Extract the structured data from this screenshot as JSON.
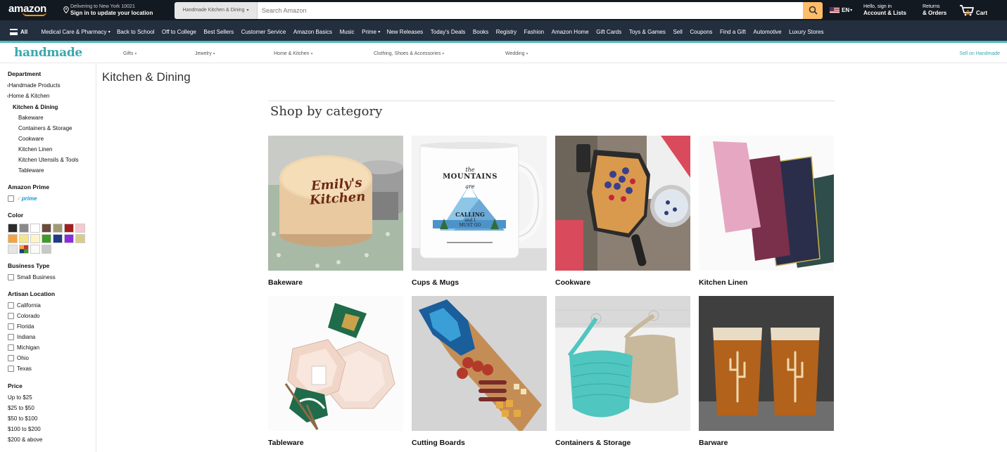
{
  "header": {
    "logo": "amazon",
    "deliver_line1": "Delivering to New York 10021",
    "deliver_line2": "Sign in to update your location",
    "search_department": "Handmade Kitchen & Dining",
    "search_placeholder": "Search Amazon",
    "language": "EN",
    "account_line1": "Hello, sign in",
    "account_line2": "Account & Lists",
    "returns_line1": "Returns",
    "returns_line2": "& Orders",
    "cart_count": "0",
    "cart_label": "Cart"
  },
  "subnav": {
    "all_label": "All",
    "items": [
      "Medical Care & Pharmacy",
      "Back to School",
      "Off to College",
      "Best Sellers",
      "Customer Service",
      "Amazon Basics",
      "Music",
      "Prime",
      "New Releases",
      "Today's Deals",
      "Books",
      "Registry",
      "Fashion",
      "Amazon Home",
      "Gift Cards",
      "Toys & Games",
      "Sell",
      "Coupons",
      "Find a Gift",
      "Automotive",
      "Luxury Stores"
    ]
  },
  "handmade": {
    "logo": "handmade",
    "links": [
      "Gifts",
      "Jewelry",
      "Home & Kitchen",
      "Clothing, Shoes & Accessories",
      "Wedding"
    ],
    "sell": "Sell on Handmade"
  },
  "sidebar": {
    "department_heading": "Department",
    "dept_parent1": "Handmade Products",
    "dept_parent2": "Home & Kitchen",
    "dept_current": "Kitchen & Dining",
    "dept_children": [
      "Bakeware",
      "Containers & Storage",
      "Cookware",
      "Kitchen Linen",
      "Kitchen Utensils & Tools",
      "Tableware"
    ],
    "prime_heading": "Amazon Prime",
    "prime_label": "prime",
    "color_heading": "Color",
    "colors": [
      "#2b2b2b",
      "#8a8a8a",
      "#ffffff",
      "#6b4a3c",
      "#a39a75",
      "#a31f1f",
      "#f8c8cf",
      "#f5a340",
      "#f2e88a",
      "#fff5c9",
      "#3f9b2a",
      "#1f3a86",
      "#8b2be2",
      "#d8cc8b",
      "#e5e5e5",
      "#multi",
      "#fafafa",
      "#c8c8c8"
    ],
    "business_heading": "Business Type",
    "business_items": [
      "Small Business"
    ],
    "artisan_heading": "Artisan Location",
    "artisan_items": [
      "California",
      "Colorado",
      "Florida",
      "Indiana",
      "Michigan",
      "Ohio",
      "Texas"
    ],
    "price_heading": "Price",
    "price_items": [
      "Up to $25",
      "$25 to $50",
      "$50 to $100",
      "$100 to $200",
      "$200 & above"
    ]
  },
  "main": {
    "page_title": "Kitchen & Dining",
    "category_heading": "Shop by category",
    "categories": [
      "Bakeware",
      "Cups & Mugs",
      "Cookware",
      "Kitchen Linen",
      "Tableware",
      "Cutting Boards",
      "Containers & Storage",
      "Barware"
    ],
    "bakeware_text1": "Emily's",
    "bakeware_text2": "Kitchen",
    "mug_line1": "the",
    "mug_line2": "MOUNTAINS",
    "mug_line3": "are",
    "mug_line4": "CALLING",
    "mug_line5": "and I",
    "mug_line6": "MUST GO"
  }
}
